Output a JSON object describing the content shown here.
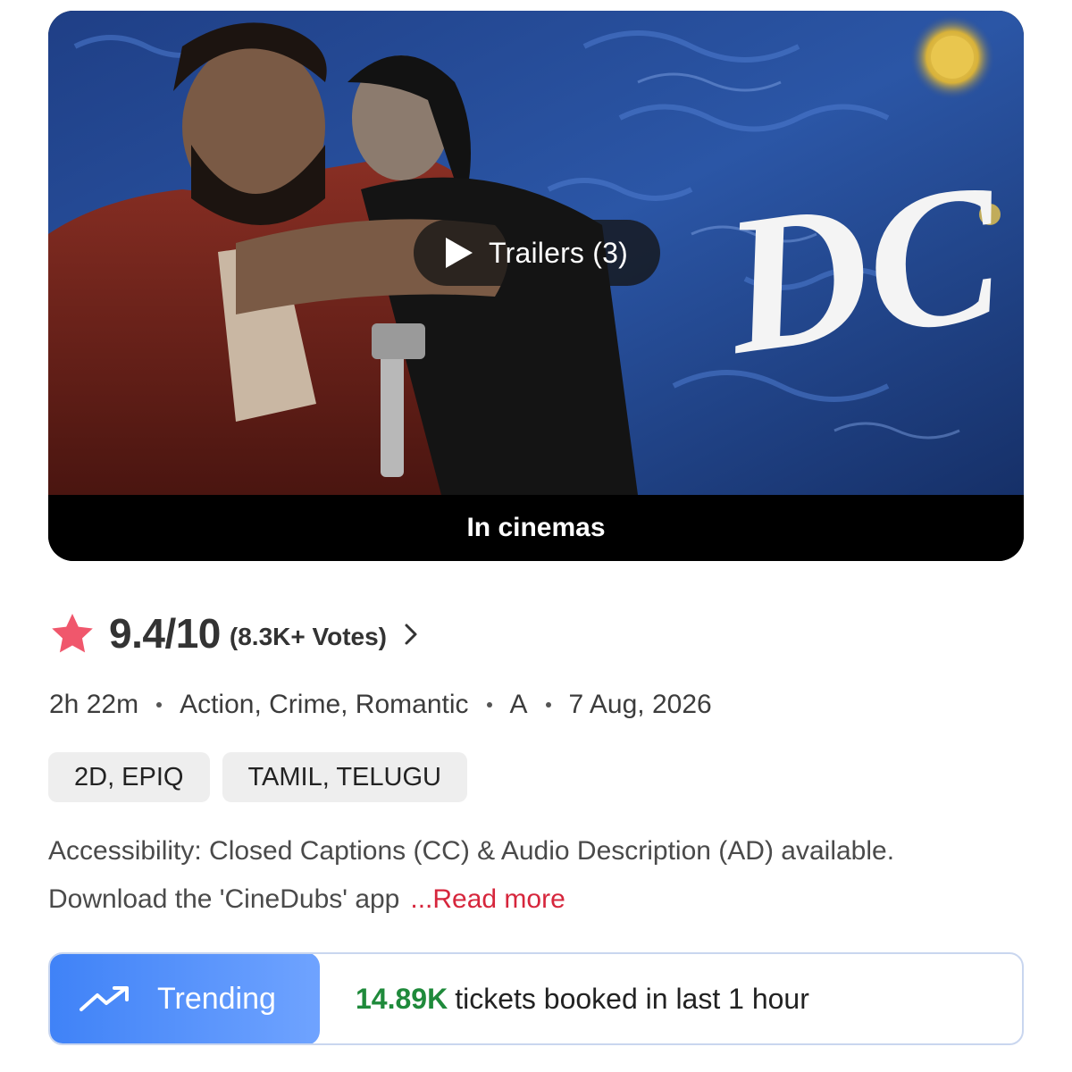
{
  "poster": {
    "title_art_text": "DC",
    "trailers_label": "Trailers (3)",
    "release_status": "In cinemas"
  },
  "rating": {
    "score": "9.4/10",
    "votes": "(8.3K+ Votes)",
    "star_color": "#f0576c"
  },
  "meta": {
    "duration": "2h 22m",
    "genres": "Action, Crime, Romantic",
    "certificate": "A",
    "release_date": "7 Aug, 2026"
  },
  "formats": [
    "2D, EPIQ",
    "TAMIL, TELUGU"
  ],
  "description": {
    "line1": "Accessibility: Closed Captions (CC) & Audio Description (AD) available.",
    "line2": "Download the 'CineDubs' app",
    "read_more": "...Read more"
  },
  "trending": {
    "label": "Trending",
    "count": "14.89K",
    "text": "tickets booked in last 1 hour",
    "badge_color": "#3f82f7",
    "count_color": "#1f8a3b"
  }
}
